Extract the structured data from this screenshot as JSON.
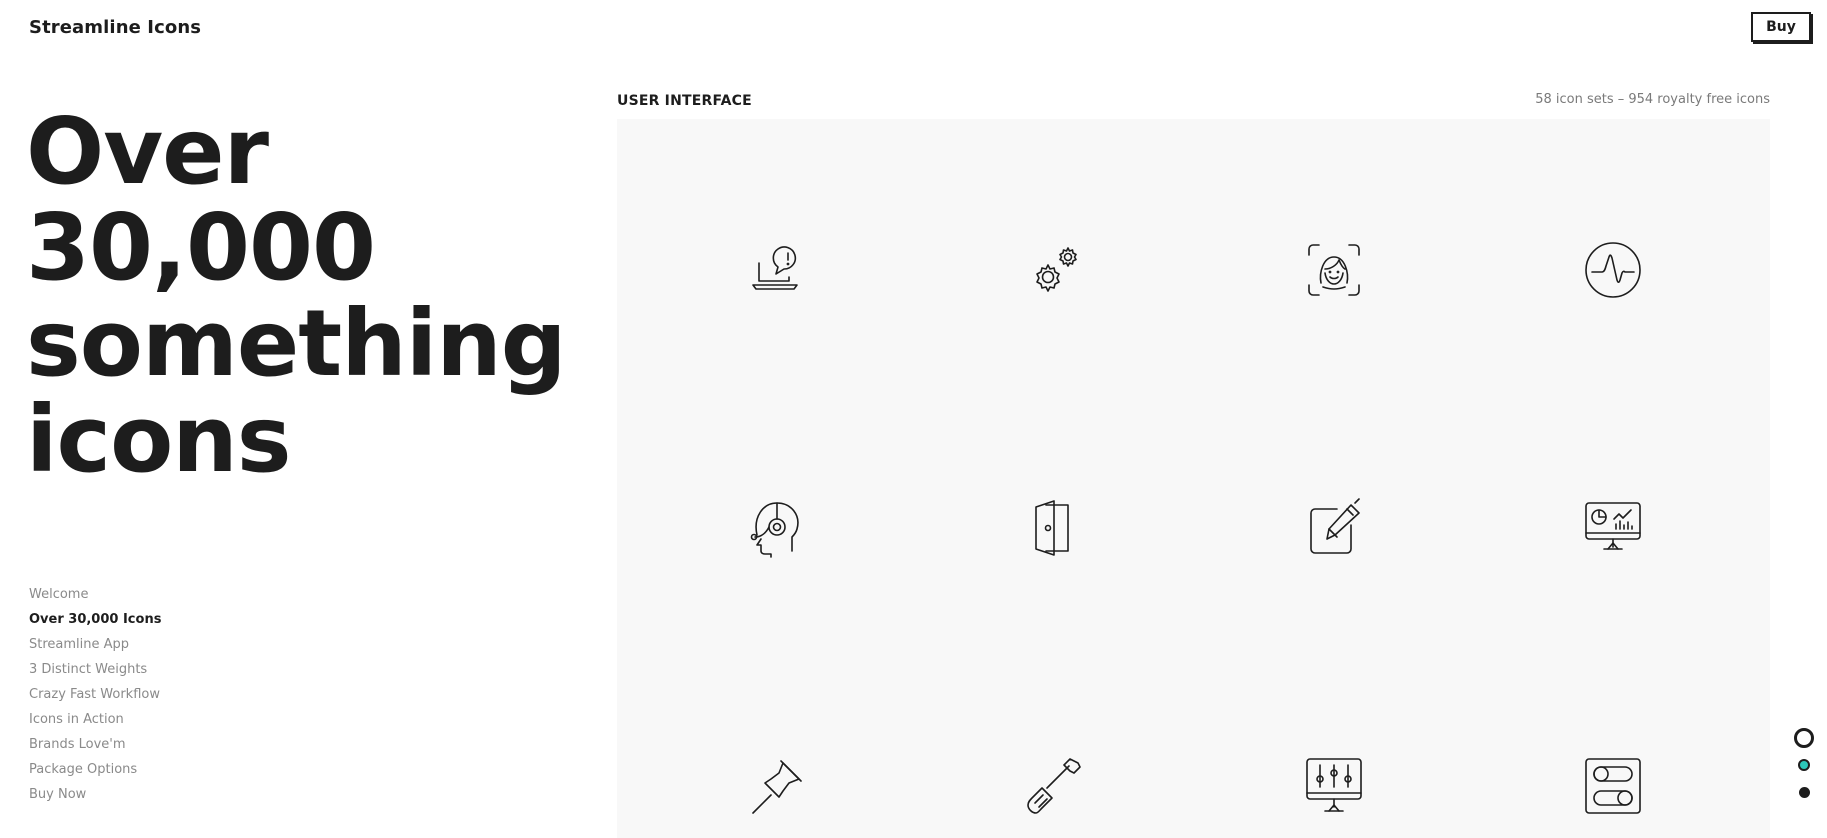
{
  "header": {
    "brand": "Streamline Icons",
    "buy_label": "Buy"
  },
  "hero": {
    "lines": [
      "Over",
      "30,000",
      "something",
      "icons"
    ]
  },
  "nav": {
    "items": [
      {
        "label": "Welcome",
        "active": false
      },
      {
        "label": "Over 30,000 Icons",
        "active": true
      },
      {
        "label": "Streamline App",
        "active": false
      },
      {
        "label": "3 Distinct Weights",
        "active": false
      },
      {
        "label": "Crazy Fast Workflow",
        "active": false
      },
      {
        "label": "Icons in Action",
        "active": false
      },
      {
        "label": "Brands Love'm",
        "active": false
      },
      {
        "label": "Package Options",
        "active": false
      },
      {
        "label": "Buy Now",
        "active": false
      }
    ]
  },
  "section": {
    "title": "USER INTERFACE",
    "meta": "58 icon sets – 954 royalty free icons"
  },
  "icons": [
    {
      "name": "laptop-alert-icon"
    },
    {
      "name": "settings-cogs-icon"
    },
    {
      "name": "face-id-woman-icon"
    },
    {
      "name": "heart-rate-pulse-icon"
    },
    {
      "name": "headset-support-icon"
    },
    {
      "name": "open-door-icon"
    },
    {
      "name": "edit-pen-square-icon"
    },
    {
      "name": "monitor-analytics-icon"
    },
    {
      "name": "pin-icon"
    },
    {
      "name": "screwdriver-icon"
    },
    {
      "name": "monitor-sliders-icon"
    },
    {
      "name": "toggle-switches-icon"
    }
  ],
  "colors": {
    "text": "#1d1d1d",
    "muted": "#8a8a8a",
    "panel_bg": "#f8f8f8",
    "accent_teal": "#2cc6b8"
  },
  "pager": {
    "dots": [
      "current-ring",
      "teal",
      "black"
    ]
  }
}
